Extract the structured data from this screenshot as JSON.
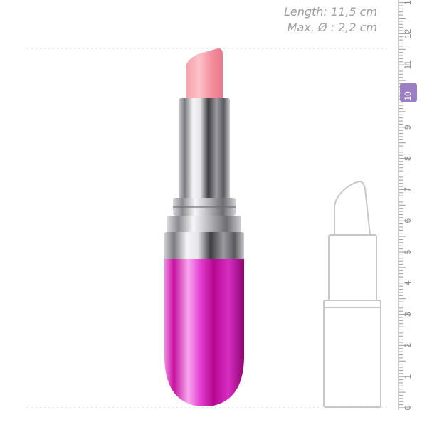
{
  "specs": {
    "length": "Length: 11,5 cm",
    "diameter": "Max. Ø : 2,2 cm"
  },
  "ruler": {
    "highlighted": "10",
    "highlight_color": "#9b7fc0",
    "labels": [
      "0",
      "1",
      "2",
      "3",
      "4",
      "5",
      "6",
      "7",
      "8",
      "9",
      "10",
      "11",
      "12",
      "1"
    ]
  },
  "colors": {
    "tip": "#f7a3b0",
    "chrome": "#b8b8bc",
    "body": "#d81fc8",
    "outline": "#c7c7c7"
  }
}
